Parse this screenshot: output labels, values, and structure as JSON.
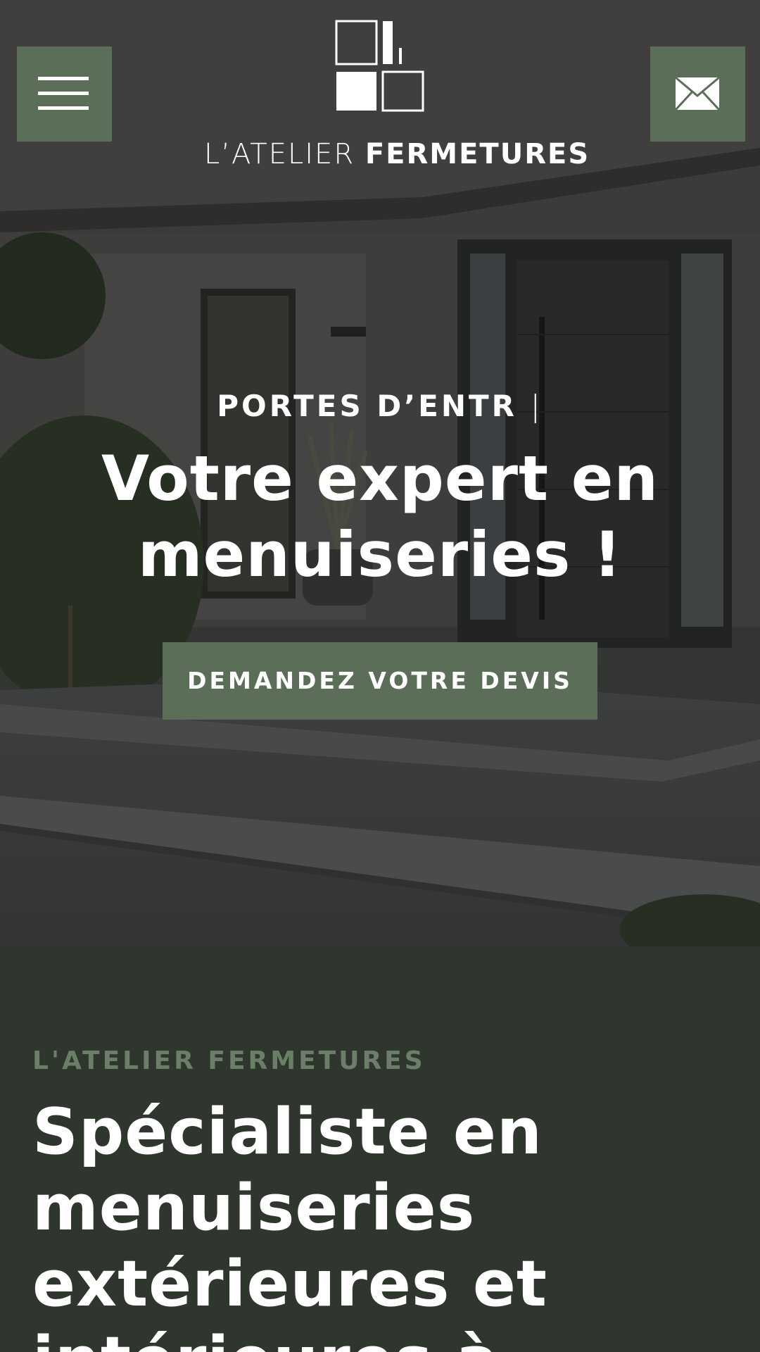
{
  "header": {
    "menu_icon": "hamburger-menu-icon",
    "contact_icon": "envelope-icon",
    "logo": {
      "name_light": "L’ATELIER",
      "name_bold": "FERMETURES"
    }
  },
  "hero": {
    "kicker": "PORTES D’ENTR",
    "caret": "|",
    "title": "Votre expert en menuiseries !",
    "cta_label": "DEMANDEZ VOTRE DEVIS"
  },
  "about": {
    "kicker": "L'ATELIER FERMETURES",
    "title": "Spécialiste en menuiseries extérieures et intérieures à"
  },
  "colors": {
    "accent": "#5b6e58",
    "section_bg": "#2f362e",
    "muted_green": "#6b7f68",
    "text": "#ffffff"
  }
}
